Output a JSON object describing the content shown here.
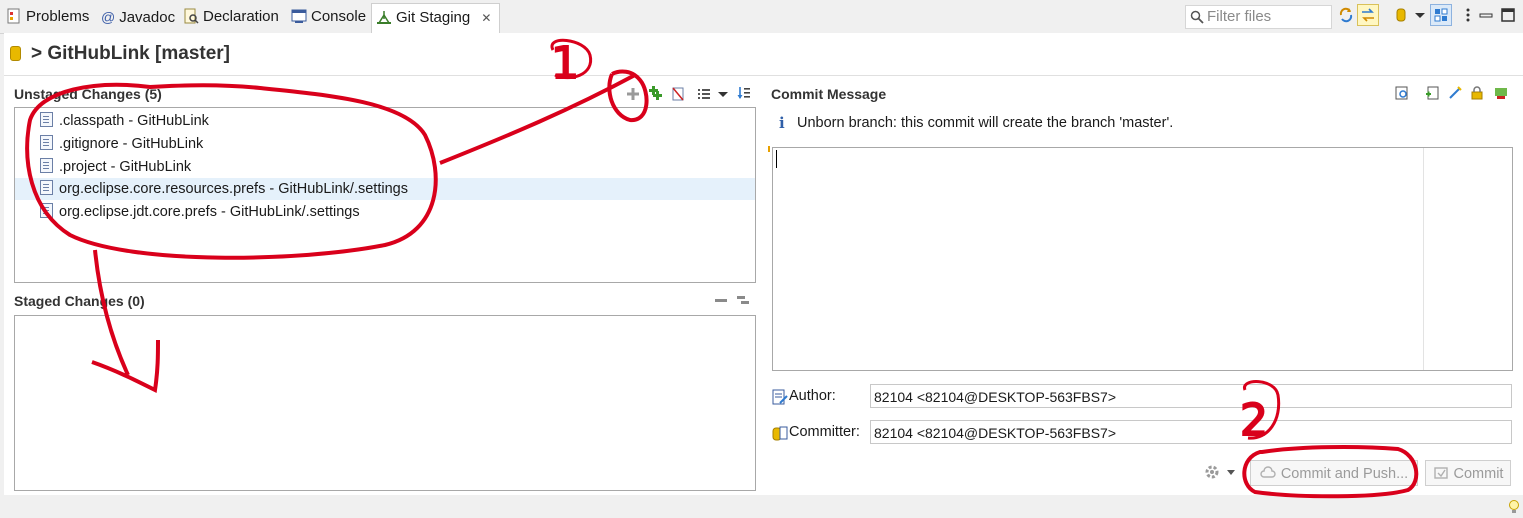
{
  "tabs": [
    {
      "label": "Problems",
      "icon": "problems-icon"
    },
    {
      "label": "Javadoc",
      "icon": "at-icon"
    },
    {
      "label": "Declaration",
      "icon": "declaration-icon"
    },
    {
      "label": "Console",
      "icon": "console-icon"
    },
    {
      "label": "Git Staging",
      "icon": "git-staging-icon",
      "active": true
    }
  ],
  "tab_close": "✕",
  "filter": {
    "placeholder": "Filter files"
  },
  "repo": {
    "title": "> GitHubLink [master]"
  },
  "unstaged": {
    "header": "Unstaged Changes (5)",
    "files": [
      ".classpath - GitHubLink",
      ".gitignore - GitHubLink",
      ".project - GitHubLink",
      "org.eclipse.core.resources.prefs - GitHubLink/.settings",
      "org.eclipse.jdt.core.prefs - GitHubLink/.settings"
    ]
  },
  "staged": {
    "header": "Staged Changes (0)"
  },
  "commit": {
    "header": "Commit Message",
    "info": "Unborn branch: this commit will create the branch 'master'.",
    "author_label": "Author:",
    "author_value": "82104 <82104@DESKTOP-563FBS7>",
    "committer_label": "Committer:",
    "committer_value": "82104 <82104@DESKTOP-563FBS7>",
    "commit_push_label": "Commit and Push...",
    "commit_label": "Commit"
  },
  "annotations": {
    "mark1": "1",
    "mark2": "2"
  },
  "colors": {
    "annotation": "#d9001b",
    "selection": "#e5f1fb",
    "accent": "#0078d7"
  }
}
